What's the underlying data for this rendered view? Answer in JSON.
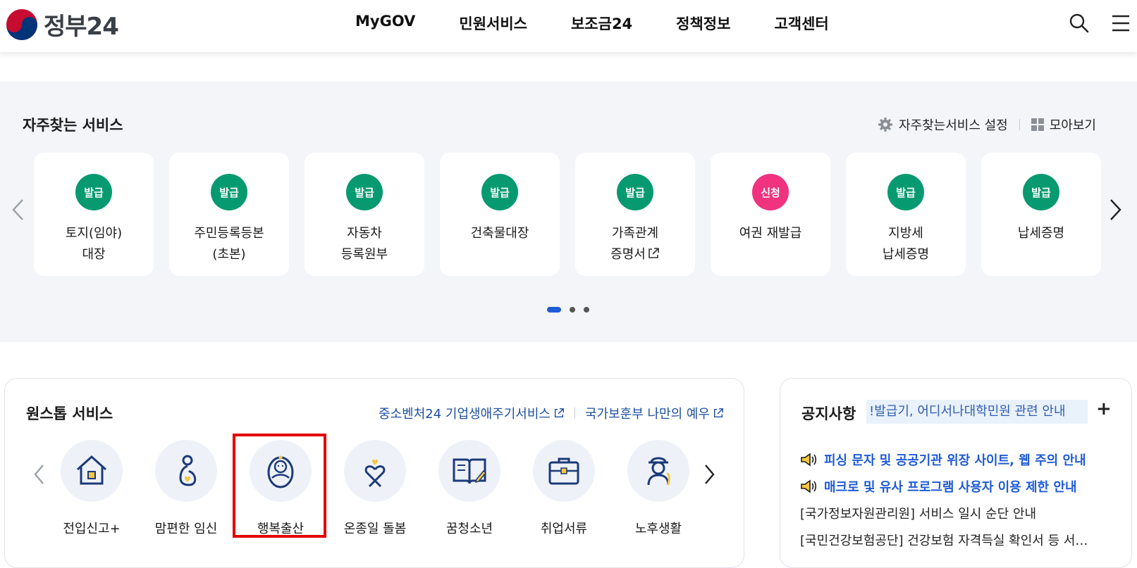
{
  "header": {
    "logo_text": "정부24",
    "nav": [
      "MyGOV",
      "민원서비스",
      "보조금24",
      "정책정보",
      "고객센터"
    ]
  },
  "frequent": {
    "title": "자주찾는 서비스",
    "settings_label": "자주찾는서비스 설정",
    "view_all_label": "모아보기",
    "cards": [
      {
        "badge": "발급",
        "line1": "토지(임야)",
        "line2": "대장"
      },
      {
        "badge": "발급",
        "line1": "주민등록등본",
        "line2": "(초본)"
      },
      {
        "badge": "발급",
        "line1": "자동차",
        "line2": "등록원부"
      },
      {
        "badge": "발급",
        "line1": "건축물대장",
        "line2": ""
      },
      {
        "badge": "발급",
        "line1": "가족관계",
        "line2": "증명서"
      },
      {
        "badge": "신청",
        "line1": "여권 재발급",
        "line2": ""
      },
      {
        "badge": "발급",
        "line1": "지방세",
        "line2": "납세증명"
      },
      {
        "badge": "발급",
        "line1": "납세증명",
        "line2": ""
      }
    ]
  },
  "onestop": {
    "title": "원스톱 서비스",
    "link1": "중소벤처24 기업생애주기서비스",
    "link2": "국가보훈부 나만의 예우",
    "items": [
      "전입신고+",
      "맘편한 임신",
      "행복출산",
      "온종일 돌봄",
      "꿈청소년",
      "취업서류",
      "노후생활"
    ]
  },
  "notice": {
    "title": "공지사항",
    "ticker": "!발급기, 어디서나대학민원 관련 안내",
    "plus": "+",
    "items": [
      "피싱 문자 및 공공기관 위장 사이트, 웹 주의 안내",
      "매크로 및 유사 프로그램 사용자 이용 제한 안내",
      "[국가정보자원관리원] 서비스 일시 순단 안내",
      "[국민건강보험공단] 건강보험 자격득실 확인서 등 서…"
    ]
  },
  "colors": {
    "badge_green": "#079a70",
    "badge_pink": "#f0327f",
    "link_blue": "#1d4fa3",
    "notice_blue": "#1e5bd6",
    "highlight_red": "#e40000"
  }
}
